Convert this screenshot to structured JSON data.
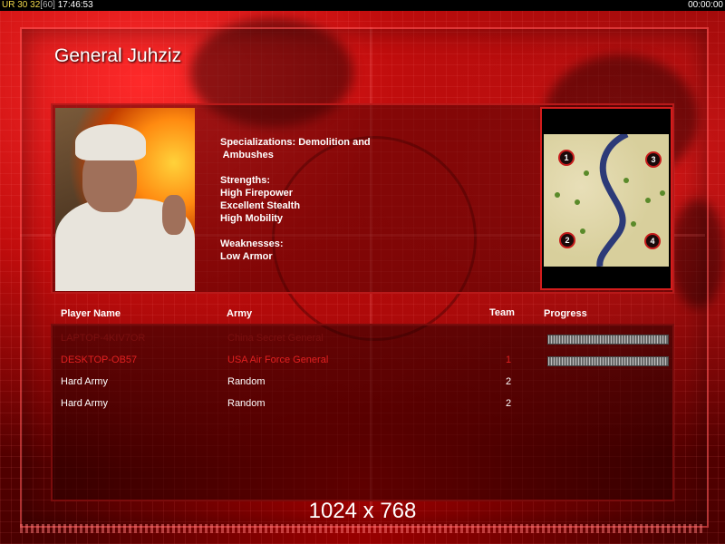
{
  "statusbar": {
    "tag": "UR",
    "num1": "30",
    "num2": "32",
    "bracket": "[60]",
    "time": "17:46:53",
    "timer": "00:00:00"
  },
  "title": "General Juhziz",
  "general": {
    "specializations_label": "Specializations: Demolition and",
    "specializations_cont": " Ambushes",
    "strengths_label": "Strengths:",
    "strengths": [
      "High Firepower",
      "Excellent Stealth",
      "High Mobility"
    ],
    "weaknesses_label": "Weaknesses:",
    "weaknesses": [
      "Low Armor"
    ]
  },
  "map": {
    "start_positions": [
      "1",
      "2",
      "3",
      "4"
    ]
  },
  "player_list": {
    "headers": {
      "name": "Player Name",
      "army": "Army",
      "team": "Team",
      "progress": "Progress"
    },
    "rows": [
      {
        "name": "LAPTOP-4KIV7OR",
        "army": "China Secret General",
        "team": "",
        "progress": 1.0,
        "color": "#7a1010"
      },
      {
        "name": "DESKTOP-OB57",
        "army": "USA Air Force General",
        "team": "1",
        "progress": 1.0,
        "color": "#e02020"
      },
      {
        "name": "Hard Army",
        "army": "Random",
        "team": "2",
        "progress": null,
        "color": "#ffffff"
      },
      {
        "name": "Hard Army",
        "army": "Random",
        "team": "2",
        "progress": null,
        "color": "#ffffff"
      }
    ]
  },
  "resolution_label": "1024 x 768",
  "colors": {
    "accent": "#c51b1b",
    "background": "#4a0000"
  }
}
